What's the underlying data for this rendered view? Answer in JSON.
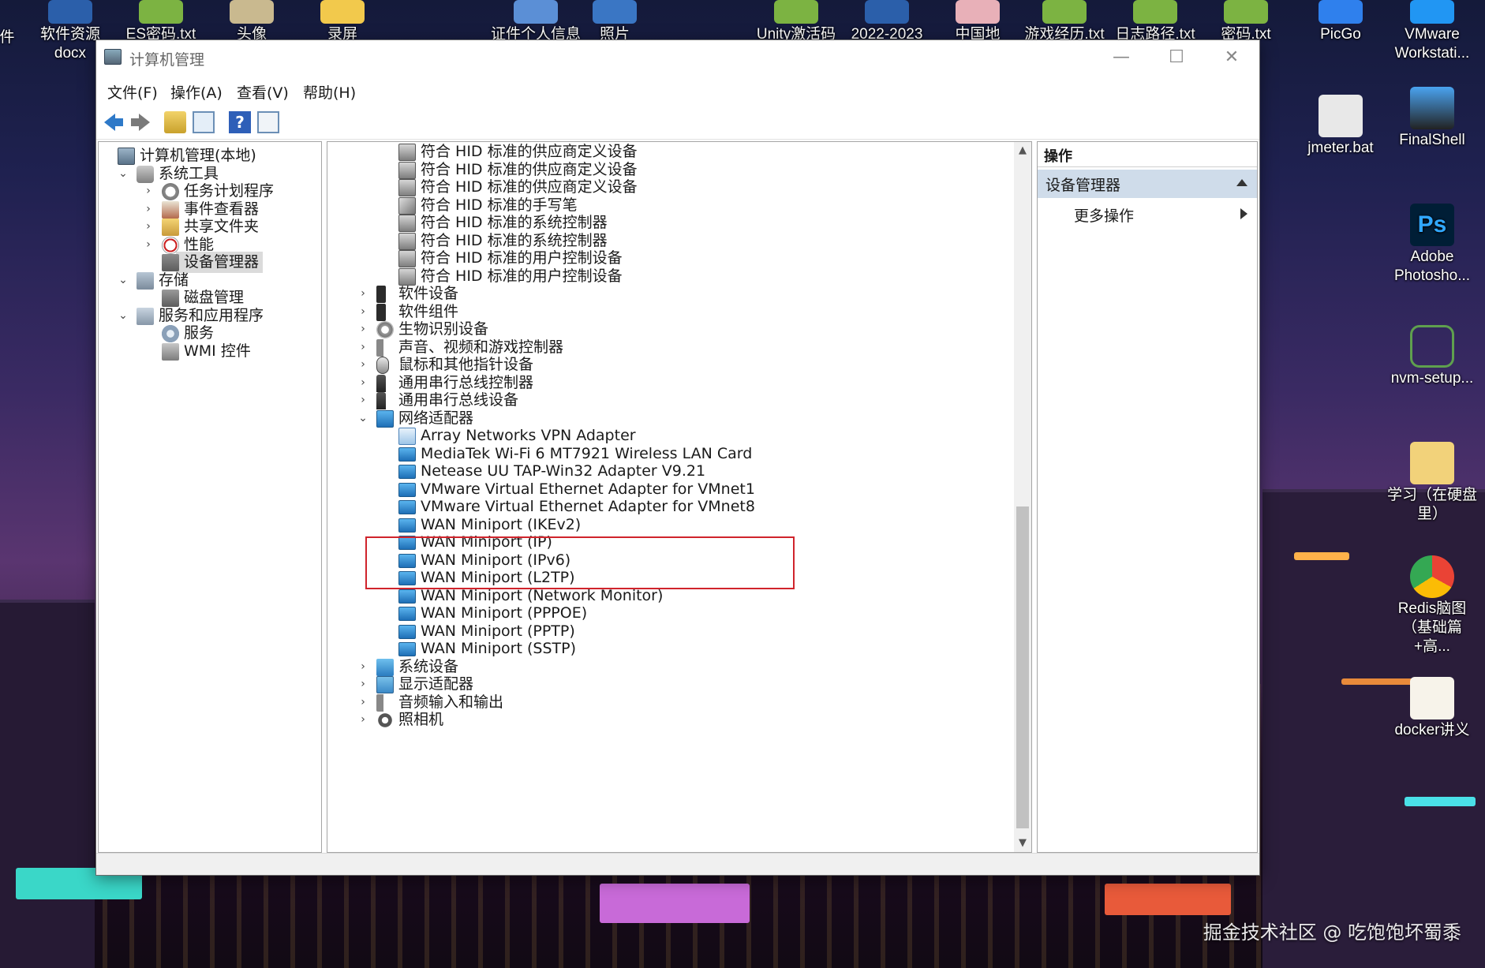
{
  "window": {
    "title": "计算机管理",
    "min_glyph": "—",
    "max_glyph": "☐",
    "close_glyph": "✕"
  },
  "menu": [
    "文件(F)",
    "操作(A)",
    "查看(V)",
    "帮助(H)"
  ],
  "toolbar": {
    "back": "back-arrow-icon",
    "forward": "forward-arrow-icon",
    "up": "up-folder-icon",
    "show_hide_tree": "console-tree-icon",
    "help": "?",
    "properties": "properties-icon"
  },
  "left_tree": [
    {
      "label": "计算机管理(本地)",
      "level": 0,
      "icon": "computer-management-icon",
      "expander": ""
    },
    {
      "label": "系统工具",
      "level": 1,
      "icon": "system-tools-icon",
      "expander": "⌄"
    },
    {
      "label": "任务计划程序",
      "level": 2,
      "icon": "task-scheduler-icon",
      "expander": "›"
    },
    {
      "label": "事件查看器",
      "level": 2,
      "icon": "event-viewer-icon",
      "expander": "›"
    },
    {
      "label": "共享文件夹",
      "level": 2,
      "icon": "shared-folders-icon",
      "expander": "›"
    },
    {
      "label": "性能",
      "level": 2,
      "icon": "performance-icon",
      "expander": "›"
    },
    {
      "label": "设备管理器",
      "level": 2,
      "icon": "device-manager-icon",
      "expander": "",
      "selected": true
    },
    {
      "label": "存储",
      "level": 1,
      "icon": "storage-icon",
      "expander": "⌄"
    },
    {
      "label": "磁盘管理",
      "level": 2,
      "icon": "disk-management-icon",
      "expander": ""
    },
    {
      "label": "服务和应用程序",
      "level": 1,
      "icon": "services-apps-icon",
      "expander": "⌄"
    },
    {
      "label": "服务",
      "level": 2,
      "icon": "services-gear-icon",
      "expander": ""
    },
    {
      "label": "WMI 控件",
      "level": 2,
      "icon": "wmi-control-icon",
      "expander": ""
    }
  ],
  "device_tree": [
    {
      "label": "符合 HID 标准的供应商定义设备",
      "indent": 1,
      "icon": "hid-device-icon",
      "expander": ""
    },
    {
      "label": "符合 HID 标准的供应商定义设备",
      "indent": 1,
      "icon": "hid-device-icon",
      "expander": ""
    },
    {
      "label": "符合 HID 标准的供应商定义设备",
      "indent": 1,
      "icon": "hid-device-icon",
      "expander": ""
    },
    {
      "label": "符合 HID 标准的手写笔",
      "indent": 1,
      "icon": "hid-pen-icon",
      "expander": ""
    },
    {
      "label": "符合 HID 标准的系统控制器",
      "indent": 1,
      "icon": "hid-device-icon",
      "expander": ""
    },
    {
      "label": "符合 HID 标准的系统控制器",
      "indent": 1,
      "icon": "hid-device-icon",
      "expander": ""
    },
    {
      "label": "符合 HID 标准的用户控制设备",
      "indent": 1,
      "icon": "hid-device-icon",
      "expander": ""
    },
    {
      "label": "符合 HID 标准的用户控制设备",
      "indent": 1,
      "icon": "hid-device-icon",
      "expander": ""
    },
    {
      "label": "软件设备",
      "indent": 0,
      "icon": "software-device-icon",
      "expander": "›"
    },
    {
      "label": "软件组件",
      "indent": 0,
      "icon": "software-component-icon",
      "expander": "›"
    },
    {
      "label": "生物识别设备",
      "indent": 0,
      "icon": "biometric-icon",
      "expander": "›"
    },
    {
      "label": "声音、视频和游戏控制器",
      "indent": 0,
      "icon": "sound-icon",
      "expander": "›"
    },
    {
      "label": "鼠标和其他指针设备",
      "indent": 0,
      "icon": "mouse-icon",
      "expander": "›"
    },
    {
      "label": "通用串行总线控制器",
      "indent": 0,
      "icon": "usb-icon",
      "expander": "›"
    },
    {
      "label": "通用串行总线设备",
      "indent": 0,
      "icon": "usb-icon",
      "expander": "›"
    },
    {
      "label": "网络适配器",
      "indent": 0,
      "icon": "network-adapter-icon",
      "expander": "⌄"
    },
    {
      "label": "Array Networks VPN Adapter",
      "indent": 1,
      "icon": "vpn-adapter-icon",
      "expander": ""
    },
    {
      "label": "MediaTek Wi-Fi 6 MT7921 Wireless LAN Card",
      "indent": 1,
      "icon": "network-adapter-icon",
      "expander": ""
    },
    {
      "label": "Netease UU TAP-Win32 Adapter V9.21",
      "indent": 1,
      "icon": "network-adapter-icon",
      "expander": ""
    },
    {
      "label": "VMware Virtual Ethernet Adapter for VMnet1",
      "indent": 1,
      "icon": "network-adapter-icon",
      "expander": ""
    },
    {
      "label": "VMware Virtual Ethernet Adapter for VMnet8",
      "indent": 1,
      "icon": "network-adapter-icon",
      "expander": ""
    },
    {
      "label": "WAN Miniport (IKEv2)",
      "indent": 1,
      "icon": "network-adapter-icon",
      "expander": ""
    },
    {
      "label": "WAN Miniport (IP)",
      "indent": 1,
      "icon": "network-adapter-icon",
      "expander": ""
    },
    {
      "label": "WAN Miniport (IPv6)",
      "indent": 1,
      "icon": "network-adapter-icon",
      "expander": ""
    },
    {
      "label": "WAN Miniport (L2TP)",
      "indent": 1,
      "icon": "network-adapter-icon",
      "expander": ""
    },
    {
      "label": "WAN Miniport (Network Monitor)",
      "indent": 1,
      "icon": "network-adapter-icon",
      "expander": ""
    },
    {
      "label": "WAN Miniport (PPPOE)",
      "indent": 1,
      "icon": "network-adapter-icon",
      "expander": ""
    },
    {
      "label": "WAN Miniport (PPTP)",
      "indent": 1,
      "icon": "network-adapter-icon",
      "expander": ""
    },
    {
      "label": "WAN Miniport (SSTP)",
      "indent": 1,
      "icon": "network-adapter-icon",
      "expander": ""
    },
    {
      "label": "系统设备",
      "indent": 0,
      "icon": "system-devices-icon",
      "expander": "›"
    },
    {
      "label": "显示适配器",
      "indent": 0,
      "icon": "display-adapter-icon",
      "expander": "›"
    },
    {
      "label": "音频输入和输出",
      "indent": 0,
      "icon": "audio-io-icon",
      "expander": "›"
    },
    {
      "label": "照相机",
      "indent": 0,
      "icon": "camera-icon",
      "expander": "›"
    }
  ],
  "actions": {
    "header": "操作",
    "section": "设备管理器",
    "more": "更多操作"
  },
  "desktop_icons_top": [
    "软件资源",
    "docx",
    "ES密码.txt",
    "头像",
    "录屏",
    "证件个人信息",
    "照片",
    "Unity激活码",
    "2022-2023",
    "中国地图.JPG",
    "游戏经历.txt",
    "日志路径.txt",
    "密码.txt",
    "PicGo",
    "VMware Workstati...",
    "件"
  ],
  "desktop_icons_right": [
    "jmeter.bat",
    "FinalShell",
    "Adobe Photosho...",
    "nvm-setup...",
    "学习（在硬盘里）",
    "Redis脑图（基础篇+高...",
    "docker讲义"
  ],
  "watermark": "掘金技术社区 @ 吃饱饱坏蜀黍"
}
